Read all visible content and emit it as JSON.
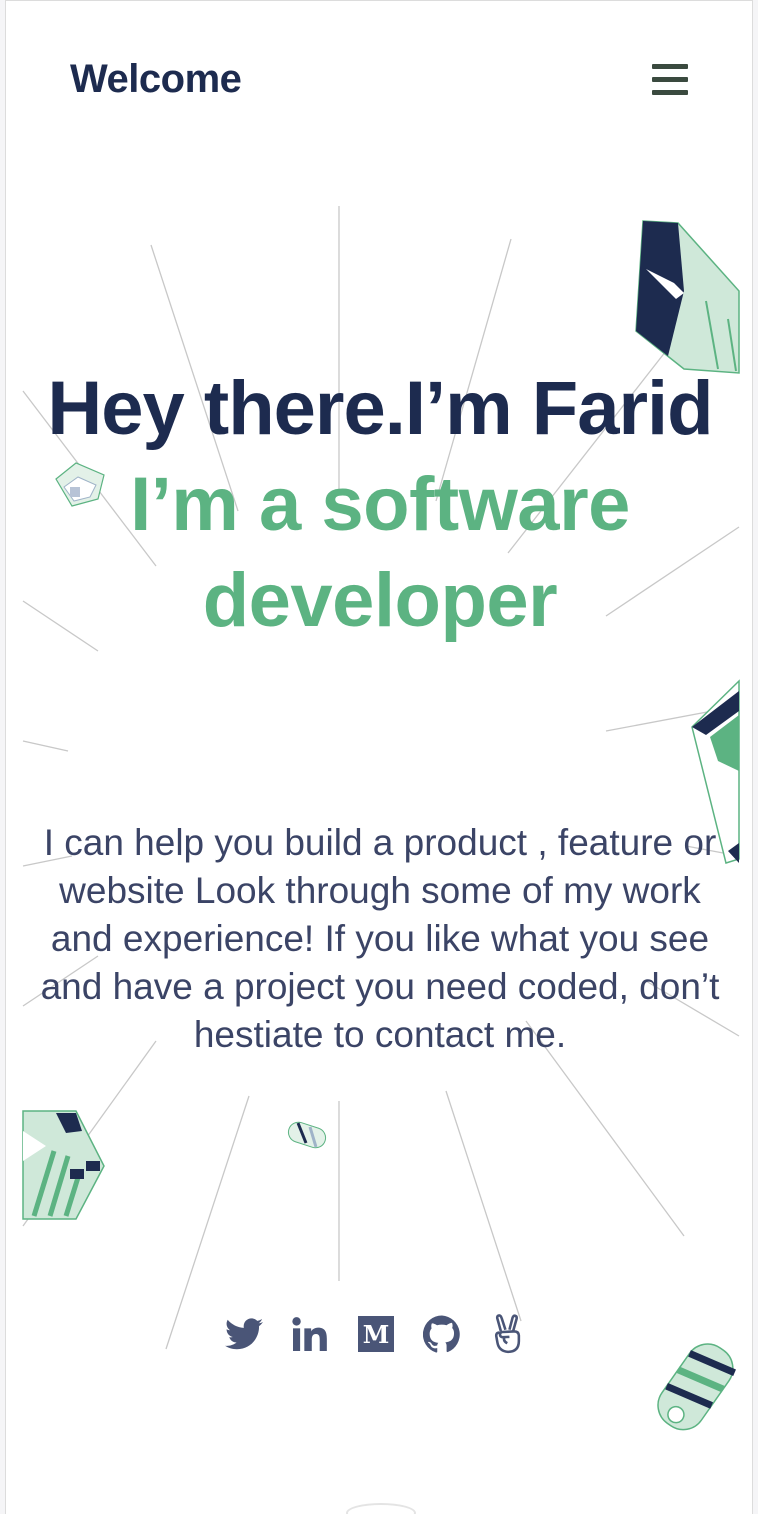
{
  "header": {
    "brand": "Welcome",
    "menu_icon": "hamburger-menu-icon"
  },
  "hero": {
    "title": "Hey there.I’m Farid",
    "subtitle": "I’m a software developer",
    "intro": "I can help you build a product , feature or website Look through some of my work and experience! If you like what you see and have a project you need coded, don’t hestiate to contact me."
  },
  "socials": [
    {
      "name": "twitter",
      "icon": "twitter-bird-icon"
    },
    {
      "name": "linkedin",
      "icon": "linkedin-in-icon"
    },
    {
      "name": "medium",
      "icon": "medium-m-icon"
    },
    {
      "name": "github",
      "icon": "github-octocat-icon"
    },
    {
      "name": "angellist",
      "icon": "angellist-peace-hand-icon"
    }
  ],
  "colors": {
    "navy": "#1d2b4f",
    "green": "#5cb382",
    "text": "#3b4466",
    "icon": "#4a5577",
    "mint": "#cfe8d9"
  }
}
